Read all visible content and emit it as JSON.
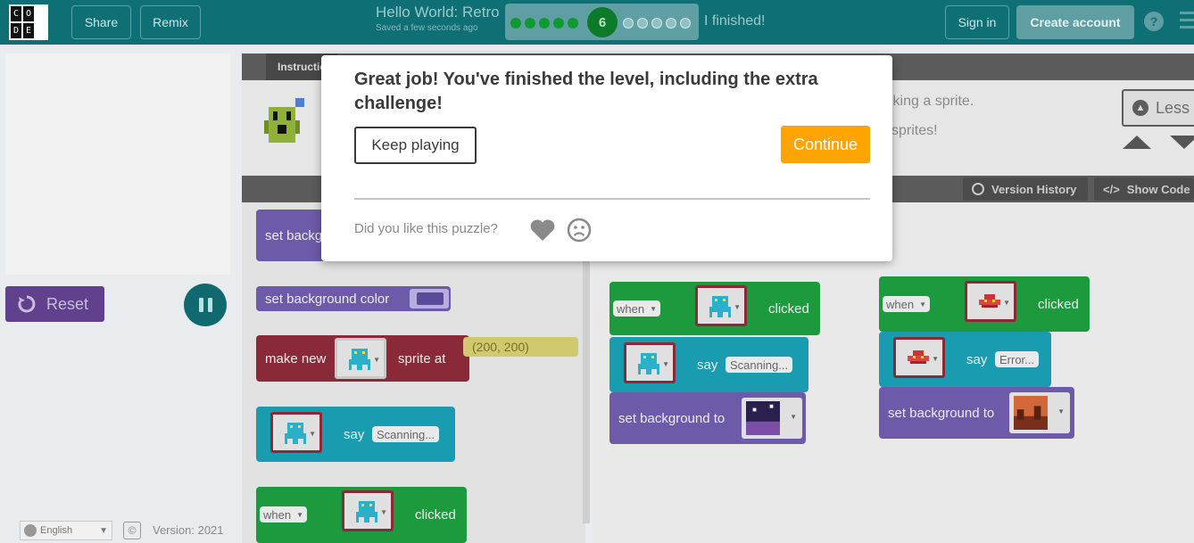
{
  "header": {
    "logo_letters": [
      "C",
      "O",
      "",
      "D",
      "E",
      ""
    ],
    "share_label": "Share",
    "remix_label": "Remix",
    "project_title": "Hello World: Retro",
    "saved_text": "Saved a few seconds ago",
    "current_level": "6",
    "completed_levels": 5,
    "remaining_levels": 5,
    "finished_label": "I finished!",
    "sign_in_label": "Sign in",
    "create_account_label": "Create account",
    "help_label": "?"
  },
  "left": {
    "reset_label": "Reset",
    "language": "English",
    "copyright_symbol": "©",
    "version_text": "Version: 2021"
  },
  "instructions": {
    "tab_label": "Instructions",
    "line1": "icking a sprite.",
    "line2": "sprites!",
    "less_label": "Less",
    "version_history_label": "Version History",
    "show_code_label": "Show Code"
  },
  "toolbox": {
    "set_background_partial": "set backg",
    "set_background_color": "set background color",
    "make_new": "make new",
    "sprite_at": "sprite at",
    "coord_value": "(200, 200)",
    "say": "say",
    "scanning": "Scanning...",
    "when": "when",
    "clicked": "clicked"
  },
  "workspace": {
    "when": "when",
    "clicked": "clicked",
    "say": "say",
    "scanning": "Scanning...",
    "error": "Error...",
    "set_background_to": "set background to"
  },
  "modal": {
    "message": "Great job! You've finished the level, including the extra challenge!",
    "keep_playing_label": "Keep playing",
    "continue_label": "Continue",
    "feedback_question": "Did you like this puzzle?"
  },
  "colors": {
    "header": "#0e6f74",
    "continue": "#ffa400",
    "reset": "#61408e",
    "progress_done": "#0e9a2f"
  }
}
